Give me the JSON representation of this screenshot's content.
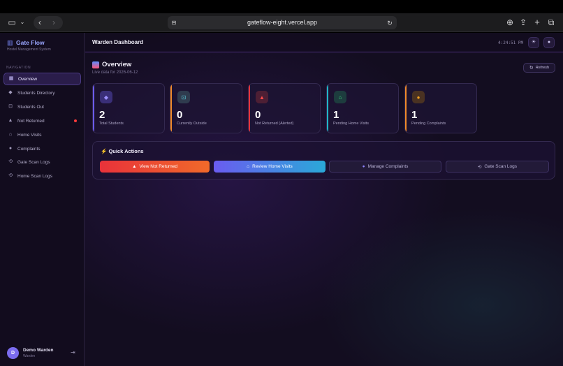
{
  "browser": {
    "url": "gateflow-eight.vercel.app"
  },
  "sidebar": {
    "brand": "Gate Flow",
    "subtitle": "Hostel Management System",
    "nav_heading": "NAVIGATION",
    "items": [
      {
        "label": "Overview",
        "icon": "grid-icon",
        "active": true
      },
      {
        "label": "Students Directory",
        "icon": "users-icon"
      },
      {
        "label": "Students Out",
        "icon": "exit-icon"
      },
      {
        "label": "Not Returned",
        "icon": "warning-icon",
        "alert": true
      },
      {
        "label": "Home Visits",
        "icon": "home-icon"
      },
      {
        "label": "Complaints",
        "icon": "info-icon"
      },
      {
        "label": "Gate Scan Logs",
        "icon": "history-icon"
      },
      {
        "label": "Home Scan Logs",
        "icon": "history-icon"
      }
    ],
    "user": {
      "initial": "D",
      "name": "Demo Warden",
      "role": "Warden"
    }
  },
  "header": {
    "title": "Warden Dashboard",
    "time": "4:24:51 PM"
  },
  "overview": {
    "title": "Overview",
    "subtitle": "Live data for 2026-06-12",
    "refresh_label": "Refresh"
  },
  "stats": [
    {
      "value": "2",
      "label": "Total Students",
      "color": "#6c5cf0",
      "icon": "users-icon"
    },
    {
      "value": "0",
      "label": "Currently Outside",
      "color": "#f08a2a",
      "icon": "exit-icon"
    },
    {
      "value": "0",
      "label": "Not Returned (Alerted)",
      "color": "#e8323a",
      "icon": "warning-icon"
    },
    {
      "value": "1",
      "label": "Pending Home Visits",
      "color": "#20b8c8",
      "icon": "home-icon"
    },
    {
      "value": "1",
      "label": "Pending Complaints",
      "color": "#f08a2a",
      "icon": "info-icon"
    }
  ],
  "quick_actions": {
    "title": "Quick Actions",
    "buttons": [
      {
        "label": "View Not Returned",
        "icon": "warning-icon"
      },
      {
        "label": "Review Home Visits",
        "icon": "home-icon"
      },
      {
        "label": "Manage Complaints",
        "icon": "info-icon"
      },
      {
        "label": "Gate Scan Logs",
        "icon": "history-icon"
      }
    ]
  }
}
